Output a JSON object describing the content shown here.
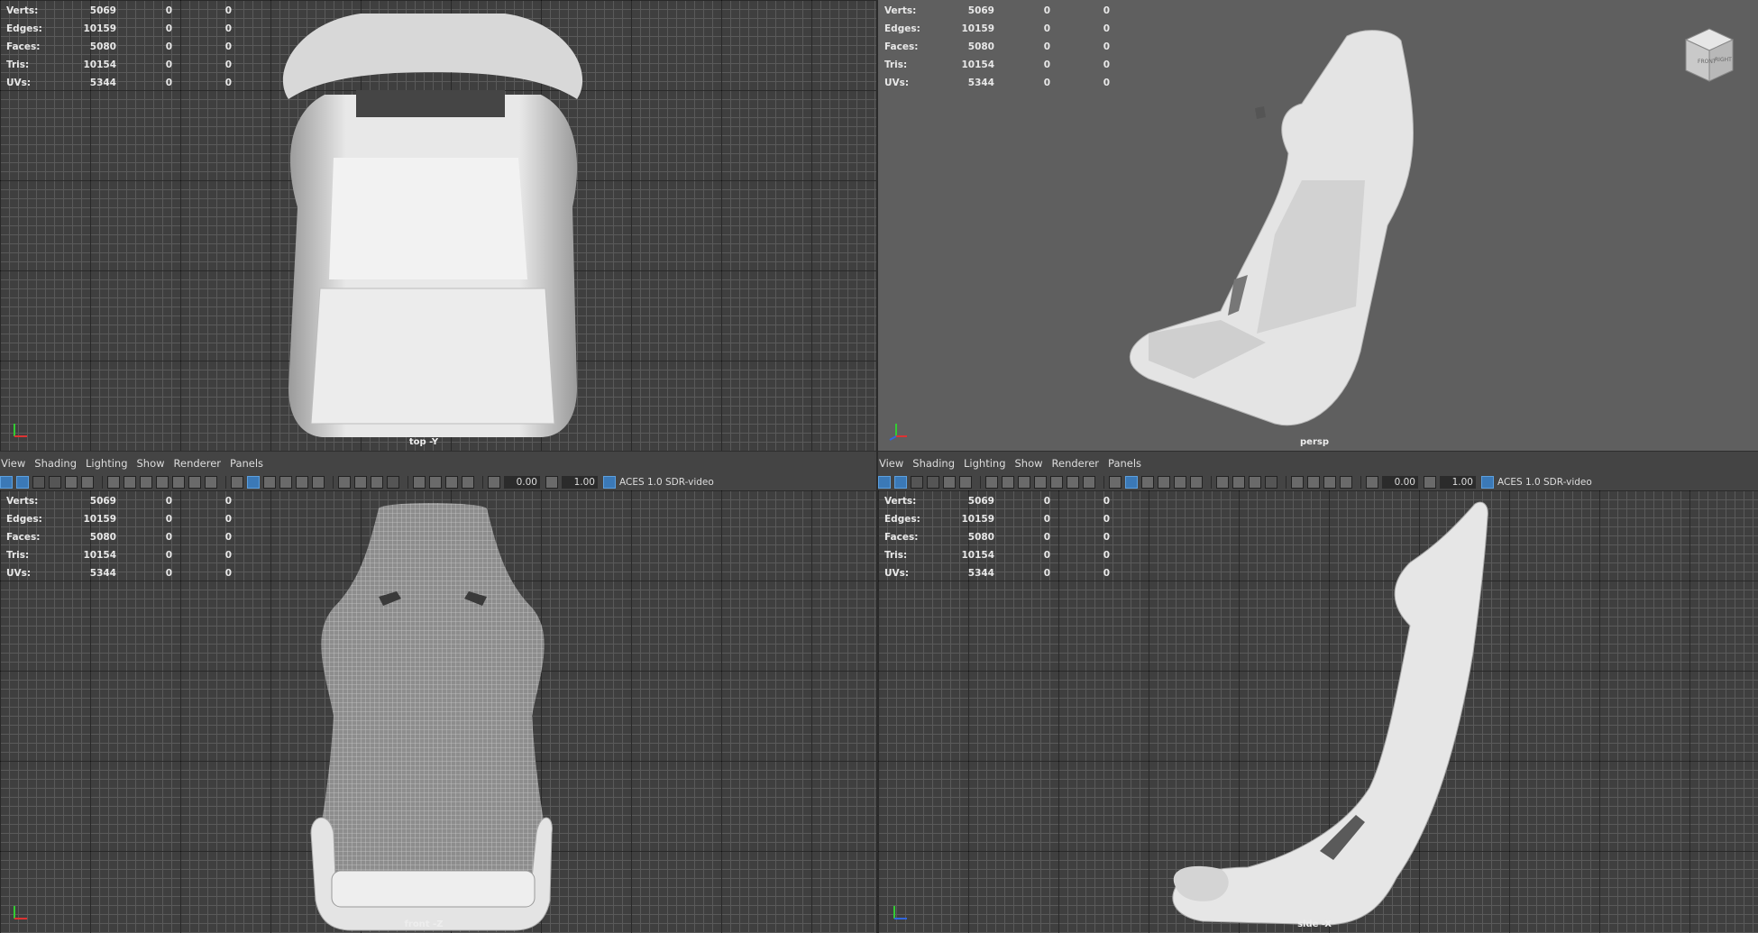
{
  "stats": {
    "labels": [
      "Verts:",
      "Edges:",
      "Faces:",
      "Tris:",
      "UVs:"
    ],
    "values": [
      [
        "5069",
        "0",
        "0"
      ],
      [
        "10159",
        "0",
        "0"
      ],
      [
        "5080",
        "0",
        "0"
      ],
      [
        "10154",
        "0",
        "0"
      ],
      [
        "5344",
        "0",
        "0"
      ]
    ]
  },
  "viewports": {
    "top": "top -Y",
    "persp": "persp",
    "front": "front -Z",
    "side": "side -X"
  },
  "panel_menu": [
    "View",
    "Shading",
    "Lighting",
    "Show",
    "Renderer",
    "Panels"
  ],
  "toolbar": {
    "exposure": "0.00",
    "gamma": "1.00",
    "colorspace": "ACES 1.0 SDR-video"
  },
  "viewcube": {
    "front": "FRONT",
    "right": "RIGHT"
  },
  "axis": {
    "y": "Y",
    "x": "X",
    "z": "Z"
  }
}
